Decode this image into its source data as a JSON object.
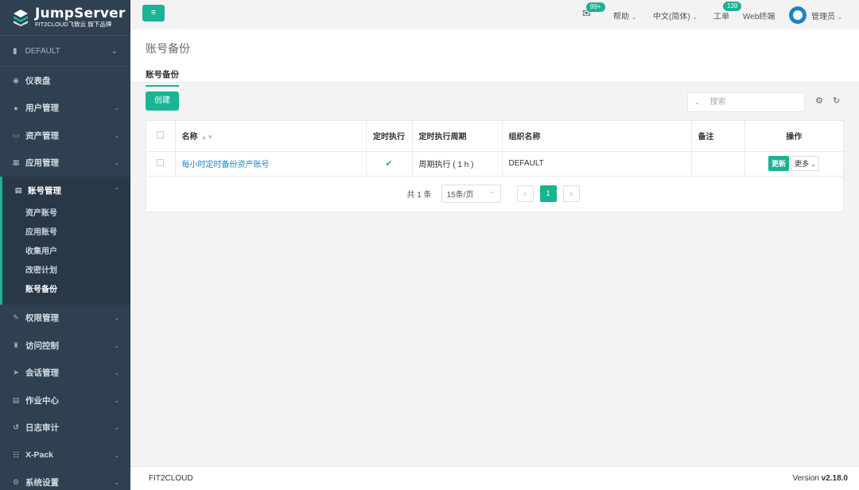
{
  "app": {
    "title": "JumpServer",
    "subtitle": "FIT2CLOUD飞致云 旗下品牌"
  },
  "sidebar": {
    "org": "DEFAULT",
    "items": [
      {
        "label": "仪表盘",
        "icon": "dashboard-icon",
        "chevron": false
      },
      {
        "label": "用户管理",
        "icon": "users-icon",
        "chevron": true
      },
      {
        "label": "资产管理",
        "icon": "inbox-icon",
        "chevron": true
      },
      {
        "label": "应用管理",
        "icon": "grid-icon",
        "chevron": true
      },
      {
        "label": "账号管理",
        "icon": "account-icon",
        "chevron": true,
        "active": true
      }
    ],
    "subitems": [
      "资产账号",
      "应用账号",
      "收集用户",
      "改密计划",
      "账号备份"
    ],
    "items_after": [
      {
        "label": "权限管理",
        "icon": "edit-icon"
      },
      {
        "label": "访问控制",
        "icon": "access-icon"
      },
      {
        "label": "会话管理",
        "icon": "rocket-icon"
      },
      {
        "label": "作业中心",
        "icon": "job-icon"
      },
      {
        "label": "日志审计",
        "icon": "history-icon"
      },
      {
        "label": "X-Pack",
        "icon": "sitemap-icon"
      },
      {
        "label": "系统设置",
        "icon": "settings-icon"
      }
    ]
  },
  "topbar": {
    "messages_badge": "99+",
    "help": "帮助",
    "language": "中文(简体)",
    "tickets": "工单",
    "tickets_badge": "139",
    "web_terminal": "Web终端",
    "user": "管理员"
  },
  "page": {
    "title": "账号备份",
    "tab": "账号备份",
    "create_label": "创建",
    "search_placeholder": "搜索"
  },
  "table": {
    "headers": [
      "名称",
      "定时执行",
      "定时执行周期",
      "组织名称",
      "备注",
      "操作"
    ],
    "rows": [
      {
        "name": "每小时定时备份资产账号",
        "periodic": true,
        "period": "周期执行 ( 1 h )",
        "org": "DEFAULT",
        "comment": "",
        "update_label": "更新",
        "more_label": "更多"
      }
    ]
  },
  "pagination": {
    "total": "共 1 条",
    "page_size": "15条/页",
    "current": "1"
  },
  "footer": {
    "left": "FIT2CLOUD",
    "version_prefix": "Version ",
    "version": "v2.18.0"
  },
  "colors": {
    "accent": "#1ab394",
    "sidebar": "#2f4050",
    "link": "#1c84c6"
  }
}
